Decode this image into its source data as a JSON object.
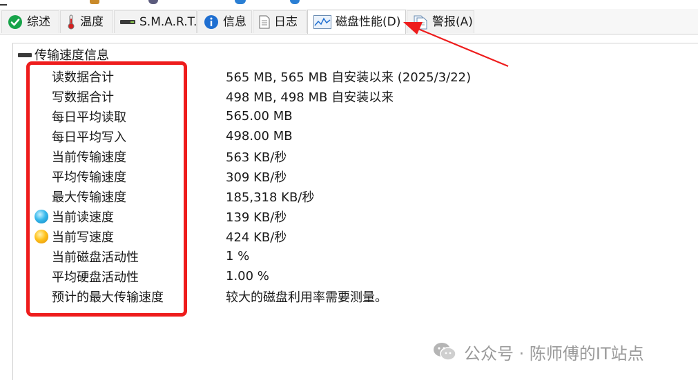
{
  "tabs": [
    {
      "label": "综述",
      "icon": "check-circle-icon"
    },
    {
      "label": "温度",
      "icon": "thermometer-icon"
    },
    {
      "label": "S.M.A.R.T.",
      "icon": "drive-icon"
    },
    {
      "label": "信息",
      "icon": "info-icon"
    },
    {
      "label": "日志",
      "icon": "document-icon"
    },
    {
      "label": "磁盘性能(D)",
      "icon": "performance-chart-icon",
      "active": true
    },
    {
      "label": "警报(A)",
      "icon": "alert-doc-icon"
    }
  ],
  "group": {
    "title": "传输速度信息",
    "icon": "drive-icon",
    "rows": [
      {
        "key": "读数据合计",
        "value": "565 MB,  565 MB 自安装以来  (2025/3/22)"
      },
      {
        "key": "写数据合计",
        "value": "498 MB,  498 MB 自安装以来"
      },
      {
        "key": "每日平均读取",
        "value": "565.00 MB"
      },
      {
        "key": "每日平均写入",
        "value": "498.00 MB"
      },
      {
        "key": "当前传输速度",
        "value": "563 KB/秒"
      },
      {
        "key": "平均传输速度",
        "value": "309 KB/秒"
      },
      {
        "key": "最大传输速度",
        "value": "185,318 KB/秒"
      },
      {
        "key": "当前读速度",
        "value": "139 KB/秒",
        "marker": "blue"
      },
      {
        "key": "当前写速度",
        "value": "424 KB/秒",
        "marker": "orange"
      },
      {
        "key": "当前磁盘活动性",
        "value": "1 %"
      },
      {
        "key": "平均硬盘活动性",
        "value": "1.00 %"
      },
      {
        "key": "预计的最大传输速度",
        "value": "较大的磁盘利用率需要测量。"
      }
    ]
  },
  "watermark": {
    "text": "公众号 · 陈师傅的IT站点",
    "icon": "wechat-icon"
  },
  "colors": {
    "annotation": "#ee1c1c",
    "marker_blue": "#38b9ec",
    "marker_orange": "#ffc21c"
  }
}
